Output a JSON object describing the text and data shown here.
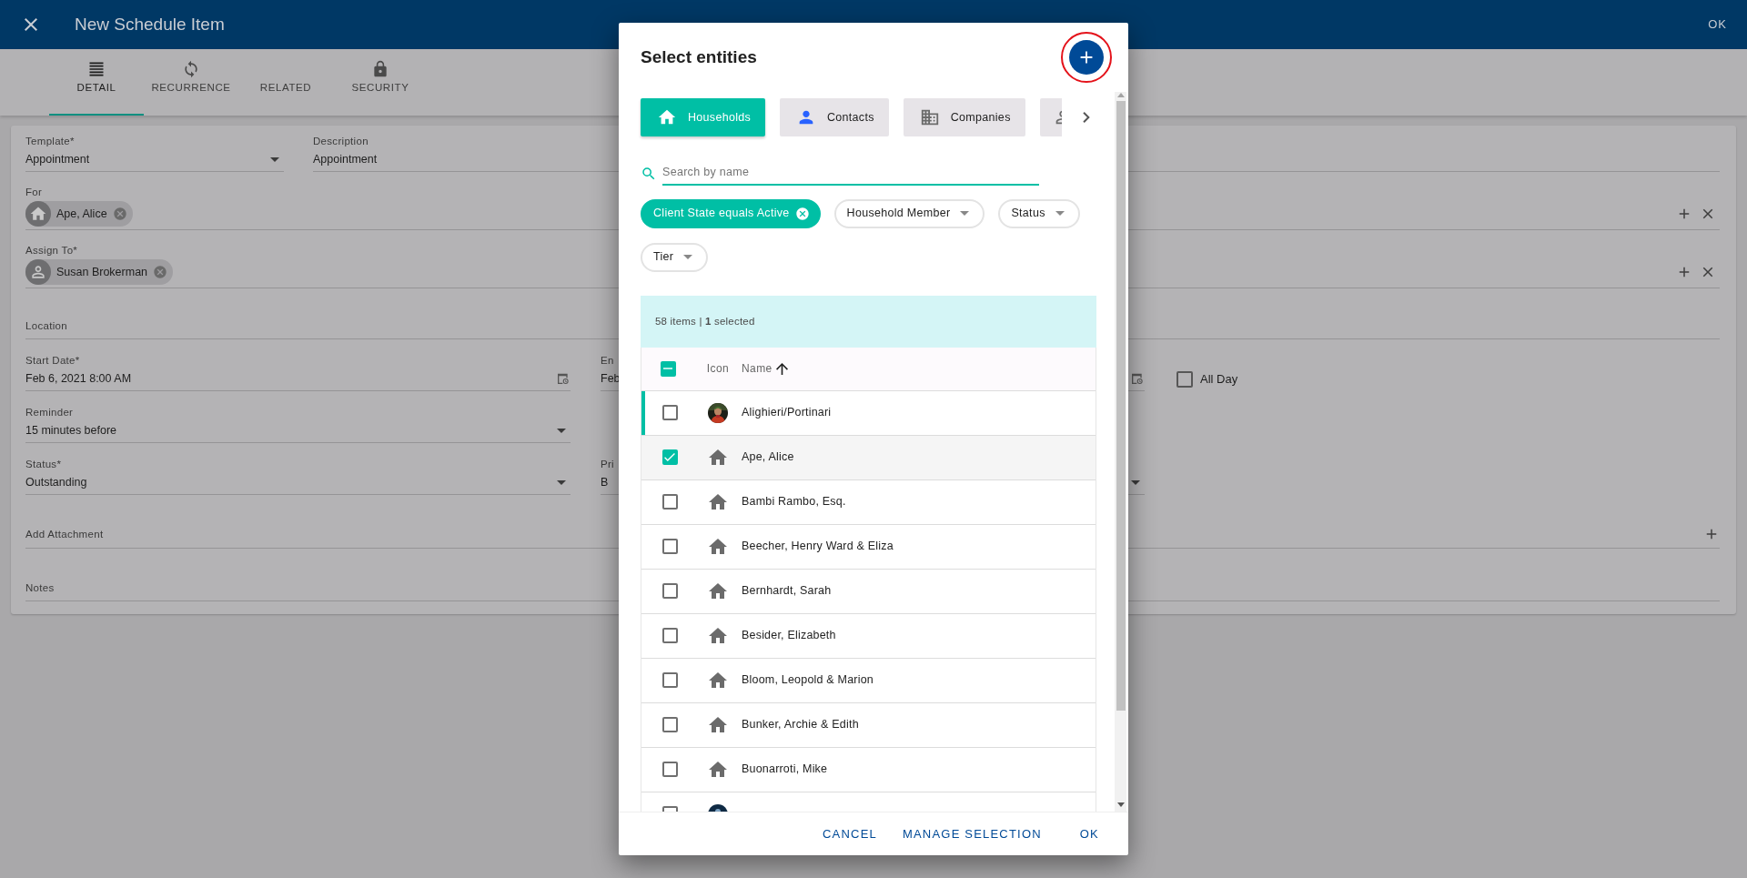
{
  "app_bar": {
    "title": "New Schedule Item",
    "action": "OK"
  },
  "tabs": [
    {
      "label": "DETAIL",
      "selected": true
    },
    {
      "label": "RECURRENCE",
      "selected": false
    },
    {
      "label": "RELATED",
      "selected": false
    },
    {
      "label": "SECURITY",
      "selected": false
    }
  ],
  "form": {
    "template": {
      "label": "Template*",
      "value": "Appointment"
    },
    "description": {
      "label": "Description",
      "value": "Appointment"
    },
    "for": {
      "label": "For",
      "chips": [
        {
          "text": "Ape, Alice",
          "kind": "household"
        }
      ]
    },
    "assign_to": {
      "label": "Assign To*",
      "chips": [
        {
          "text": "Susan Brokerman",
          "kind": "user"
        }
      ]
    },
    "location": {
      "label": "Location"
    },
    "start_date": {
      "label": "Start Date*",
      "value": "Feb 6, 2021 8:00 AM"
    },
    "end_date": {
      "label": "En",
      "value": "Feb"
    },
    "all_day": {
      "label": "All Day",
      "checked": false
    },
    "reminder": {
      "label": "Reminder",
      "value": "15 minutes before"
    },
    "status": {
      "label": "Status*",
      "value": "Outstanding"
    },
    "priority": {
      "label": "Pri",
      "value": "B"
    },
    "add_attachment": {
      "label": "Add Attachment"
    },
    "notes": {
      "label": "Notes"
    }
  },
  "dialog": {
    "title": "Select entities",
    "add_button": {
      "circled": true
    },
    "entity_types": [
      {
        "label": "Households",
        "kind": "household",
        "selected": true
      },
      {
        "label": "Contacts",
        "kind": "contact",
        "selected": false
      },
      {
        "label": "Companies",
        "kind": "company",
        "selected": false
      },
      {
        "kind": "user",
        "selected": false
      }
    ],
    "search": {
      "placeholder": "Search by name"
    },
    "filters": [
      {
        "label": "Client State equals Active",
        "active": true
      },
      {
        "label": "Household Member",
        "active": false
      },
      {
        "label": "Status",
        "active": false
      },
      {
        "label": "Tier",
        "active": false
      }
    ],
    "summary": "58 items | **1** selected",
    "select_all": {
      "indeterminate": true
    },
    "columns": [
      {
        "label": "Icon"
      },
      {
        "label": "Name",
        "sorted_ascending": true
      }
    ],
    "rows": [
      {
        "name": "Alighieri/Portinari",
        "checked": false,
        "focused": true
      },
      {
        "name": "Ape, Alice",
        "kind": "household",
        "checked": true,
        "focused": false
      },
      {
        "name": "Bambi Rambo, Esq.",
        "kind": "household",
        "checked": false,
        "focused": false
      },
      {
        "name": "Beecher, Henry Ward & Eliza",
        "kind": "household",
        "checked": false,
        "focused": false
      },
      {
        "name": "Bernhardt, Sarah",
        "kind": "household",
        "checked": false,
        "focused": false
      },
      {
        "name": "Besider, Elizabeth",
        "kind": "household",
        "checked": false,
        "focused": false
      },
      {
        "name": "Bloom, Leopold & Marion",
        "kind": "household",
        "checked": false,
        "focused": false
      },
      {
        "name": "Bunker, Archie & Edith",
        "kind": "household",
        "checked": false,
        "focused": false
      },
      {
        "name": "Buonarroti, Mike",
        "kind": "household",
        "checked": false,
        "focused": false
      },
      {
        "kind": "avatar",
        "checked": false,
        "focused": false
      }
    ],
    "buttons": [
      "CANCEL",
      "MANAGE SELECTION",
      "OK"
    ]
  }
}
